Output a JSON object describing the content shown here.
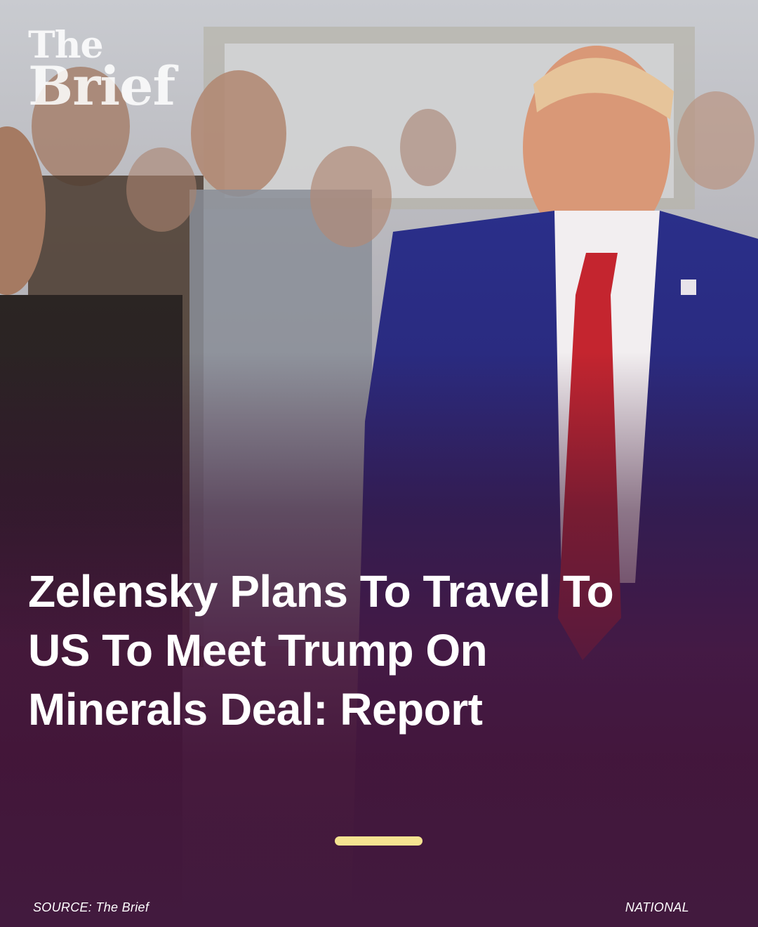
{
  "logo": {
    "line1": "The",
    "line2": "Brief"
  },
  "headline": "Zelensky Plans To Travel To US To Meet Trump On Minerals Deal: Report",
  "footer": {
    "source": "SOURCE: The Brief",
    "category": "NATIONAL"
  },
  "indicator": {
    "color": "#f5e391"
  },
  "colors": {
    "background": "#421a3e",
    "headline": "#ffffff"
  }
}
